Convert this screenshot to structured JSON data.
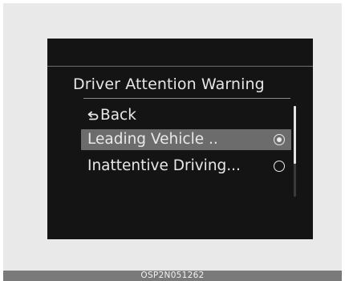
{
  "screen": {
    "title": "Driver Attention Warning",
    "items": [
      {
        "label": "Back",
        "icon": "back-arrow-icon"
      },
      {
        "label": "Leading Vehicle ..",
        "state": "selected"
      },
      {
        "label": "Inattentive Driving...",
        "state": "unselected"
      }
    ]
  },
  "caption": "OSP2N051262",
  "colors": {
    "screen_background": "#141414",
    "highlight": "#6c6c6c",
    "text": "#e8e8e8"
  }
}
